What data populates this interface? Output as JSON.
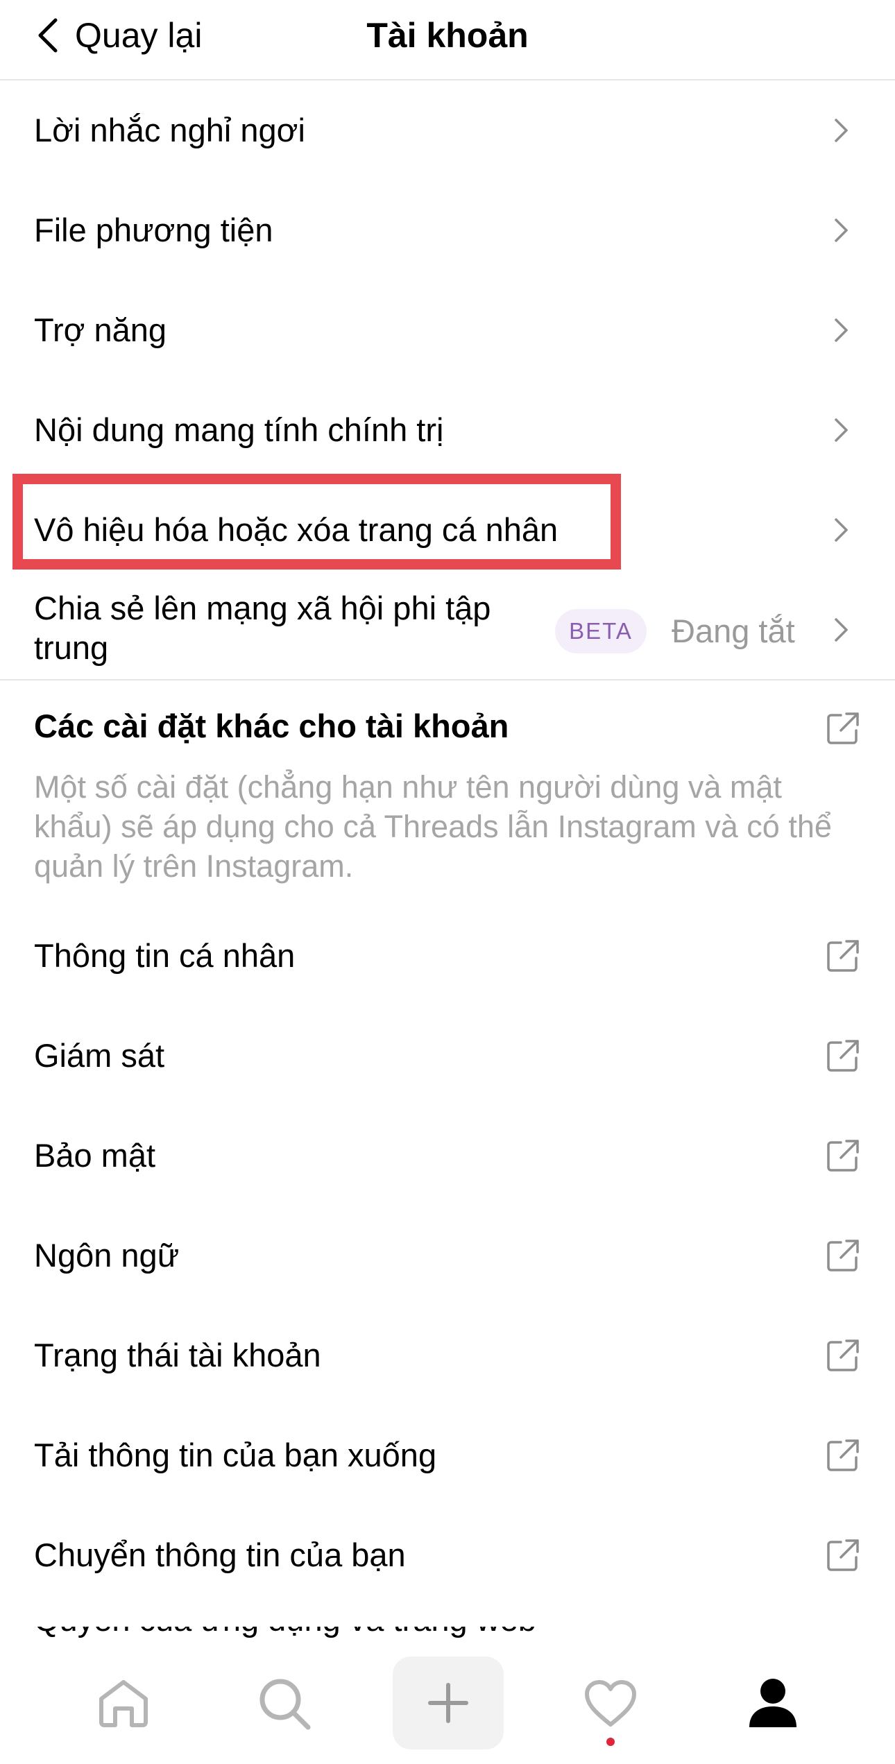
{
  "header": {
    "back_label": "Quay lại",
    "title": "Tài khoản"
  },
  "settings": [
    {
      "label": "Lời nhắc nghỉ ngơi",
      "icon": "chevron-right-icon"
    },
    {
      "label": "File phương tiện",
      "icon": "chevron-right-icon"
    },
    {
      "label": "Trợ năng",
      "icon": "chevron-right-icon"
    },
    {
      "label": "Nội dung mang tính chính trị",
      "icon": "chevron-right-icon"
    },
    {
      "label": "Vô hiệu hóa hoặc xóa trang cá nhân",
      "icon": "chevron-right-icon",
      "highlighted": true
    },
    {
      "label_line1": "Chia sẻ lên mạng xã hội phi tập",
      "label_line2": "trung",
      "badge": "BETA",
      "status": "Đang tắt",
      "icon": "chevron-right-icon"
    }
  ],
  "other_section": {
    "title": "Các cài đặt khác cho tài khoản",
    "description": "Một số cài đặt (chẳng hạn như tên người dùng và mật khẩu) sẽ áp dụng cho cả Threads lẫn Instagram và có thể quản lý trên Instagram.",
    "items": [
      {
        "label": "Thông tin cá nhân"
      },
      {
        "label": "Giám sát"
      },
      {
        "label": "Bảo mật"
      },
      {
        "label": "Ngôn ngữ"
      },
      {
        "label": "Trạng thái tài khoản"
      },
      {
        "label": "Tải thông tin của bạn xuống"
      },
      {
        "label": "Chuyển thông tin của bạn"
      }
    ],
    "partial_item": "Quyền của ứng dụng và trang web"
  },
  "tabbar": {
    "tabs": [
      "home-icon",
      "search-icon",
      "new-thread-icon",
      "heart-icon",
      "profile-icon"
    ],
    "active": "profile-icon",
    "accent_dot": "#e0243c"
  },
  "colors": {
    "highlight": "#e84850",
    "secondary_text": "#9a9a9a",
    "description_text": "#a5a5a5",
    "beta_bg": "#f3eef9",
    "beta_text": "#8a5fb0"
  }
}
